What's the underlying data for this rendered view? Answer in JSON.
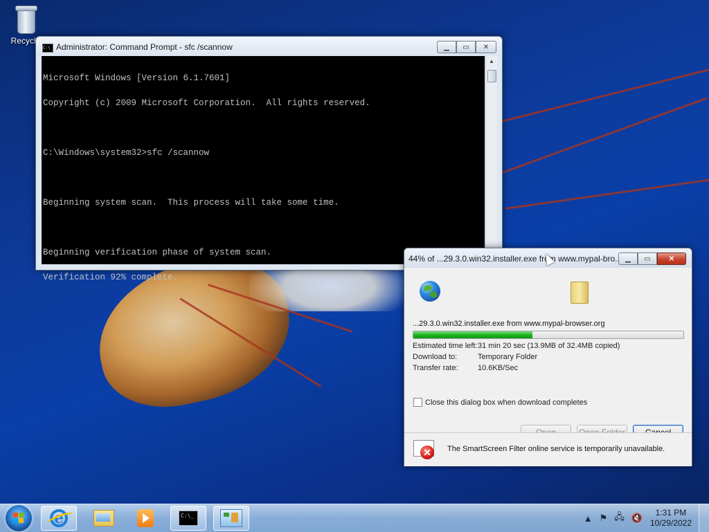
{
  "desktop": {
    "recycle_bin_label": "Recycle"
  },
  "cmd_window": {
    "title": "Administrator: Command Prompt - sfc  /scannow",
    "icon": "cmd-icon",
    "lines": [
      "Microsoft Windows [Version 6.1.7601]",
      "Copyright (c) 2009 Microsoft Corporation.  All rights reserved.",
      "",
      "C:\\Windows\\system32>sfc /scannow",
      "",
      "Beginning system scan.  This process will take some time.",
      "",
      "Beginning verification phase of system scan.",
      "Verification 92% complete."
    ]
  },
  "download_window": {
    "title": "44% of ...29.3.0.win32.installer.exe from www.mypal-bro...",
    "file_line": "...29.3.0.win32.installer.exe from www.mypal-browser.org",
    "progress_fraction": 0.44,
    "estimated_label": "Estimated time left:",
    "estimated_value": "31 min 20 sec (13.9MB of 32.4MB copied)",
    "download_to_label": "Download to:",
    "download_to_value": "Temporary Folder",
    "transfer_label": "Transfer rate:",
    "transfer_value": "10.6KB/Sec",
    "close_checkbox_label": "Close this dialog box when download completes",
    "close_checkbox_checked": false,
    "buttons": {
      "open": "Open",
      "open_folder": "Open Folder",
      "cancel": "Cancel"
    },
    "smartscreen_message": "The SmartScreen Filter online service is temporarily unavailable."
  },
  "taskbar": {
    "items": [
      {
        "name": "internet-explorer",
        "icon": "ie-icon"
      },
      {
        "name": "windows-explorer",
        "icon": "folder-icon"
      },
      {
        "name": "windows-media-player",
        "icon": "media-player-icon"
      },
      {
        "name": "command-prompt",
        "icon": "cmd-icon"
      },
      {
        "name": "control-panel",
        "icon": "control-panel-icon"
      }
    ],
    "time": "1:31 PM",
    "date": "10/29/2022"
  }
}
